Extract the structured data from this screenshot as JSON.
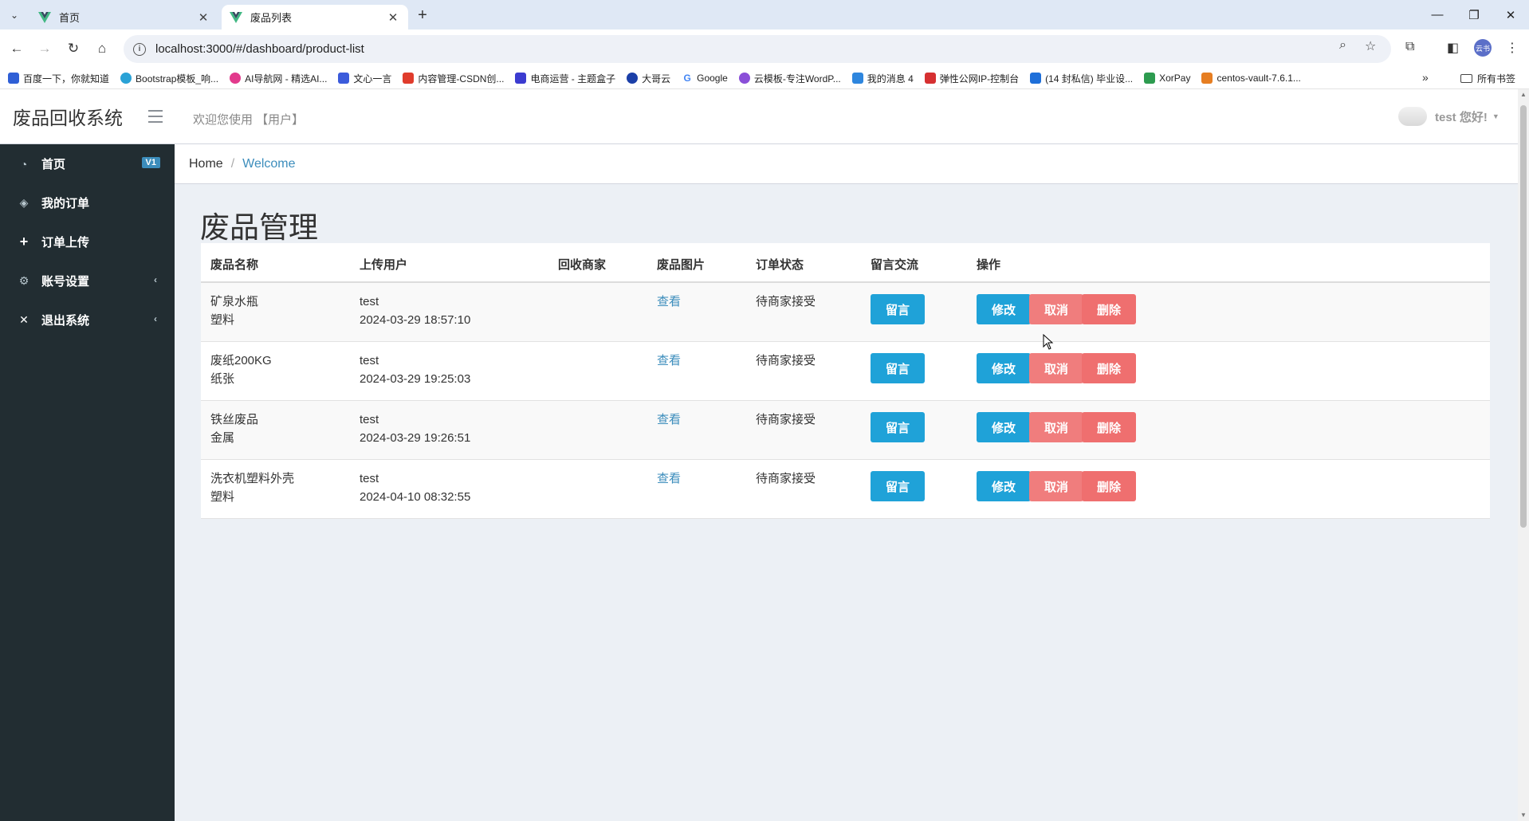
{
  "browser": {
    "tabs": [
      {
        "title": "首页",
        "active": false
      },
      {
        "title": "废品列表",
        "active": true
      }
    ],
    "url": "localhost:3000/#/dashboard/product-list",
    "bookmarks": [
      {
        "label": "百度一下，你就知道",
        "color": "#2f5fd6"
      },
      {
        "label": "Bootstrap模板_响...",
        "color": "#2aa2d6"
      },
      {
        "label": "AI导航网 - 精选AI...",
        "color": "#e23a8c"
      },
      {
        "label": "文心一言",
        "color": "#3b5bdb"
      },
      {
        "label": "内容管理-CSDN创...",
        "color": "#e03c2c"
      },
      {
        "label": "电商运营 - 主题盒子",
        "color": "#3b3bd0"
      },
      {
        "label": "大哥云",
        "color": "#1b3fa8"
      },
      {
        "label": "Google",
        "color": "#4285f4"
      },
      {
        "label": "云模板-专注WordP...",
        "color": "#8a4fd8"
      },
      {
        "label": "我的消息 4",
        "color": "#2e86de"
      },
      {
        "label": "弹性公网IP-控制台",
        "color": "#d63031"
      },
      {
        "label": "(14 封私信) 毕业设...",
        "color": "#1e6fd9"
      },
      {
        "label": "XorPay",
        "color": "#2d9b4f"
      },
      {
        "label": "centos-vault-7.6.1...",
        "color": "#e67e22"
      }
    ],
    "all_bookmarks": "所有书签",
    "profile": "云书"
  },
  "app": {
    "brand": "废品回收系统",
    "welcome": "欢迎您使用 【用户】",
    "user_greeting": "test 您好!",
    "sidebar": [
      {
        "label": "首页",
        "icon": "dashboard-icon",
        "glyph": "◔",
        "badge": "V1"
      },
      {
        "label": "我的订单",
        "icon": "cube-icon",
        "glyph": "◈"
      },
      {
        "label": "订单上传",
        "icon": "plus-icon",
        "glyph": "+"
      },
      {
        "label": "账号设置",
        "icon": "gears-icon",
        "glyph": "⚙",
        "chevron": "‹"
      },
      {
        "label": "退出系统",
        "icon": "close-icon",
        "glyph": "✕",
        "chevron": "‹"
      }
    ],
    "breadcrumb": {
      "home": "Home",
      "current": "Welcome"
    },
    "page_title": "废品管理",
    "table": {
      "headers": [
        "废品名称",
        "上传用户",
        "回收商家",
        "废品图片",
        "订单状态",
        "留言交流",
        "操作"
      ],
      "rows": [
        {
          "name": "矿泉水瓶",
          "category": "塑料",
          "user": "test",
          "time": "2024-03-29 18:57:10",
          "merchant": "",
          "image_link": "查看",
          "status": "待商家接受"
        },
        {
          "name": "废纸200KG",
          "category": "纸张",
          "user": "test",
          "time": "2024-03-29 19:25:03",
          "merchant": "",
          "image_link": "查看",
          "status": "待商家接受"
        },
        {
          "name": "铁丝废品",
          "category": "金属",
          "user": "test",
          "time": "2024-03-29 19:26:51",
          "merchant": "",
          "image_link": "查看",
          "status": "待商家接受"
        },
        {
          "name": "洗衣机塑料外壳",
          "category": "塑料",
          "user": "test",
          "time": "2024-04-10 08:32:55",
          "merchant": "",
          "image_link": "查看",
          "status": "待商家接受"
        }
      ],
      "buttons": {
        "message": "留言",
        "edit": "修改",
        "cancel": "取消",
        "delete": "删除"
      }
    }
  },
  "colors": {
    "sidebar_bg": "#222d32",
    "accent": "#3c8dbc",
    "btn_info": "#1fa2d8",
    "btn_danger": "#ef6f6f"
  }
}
